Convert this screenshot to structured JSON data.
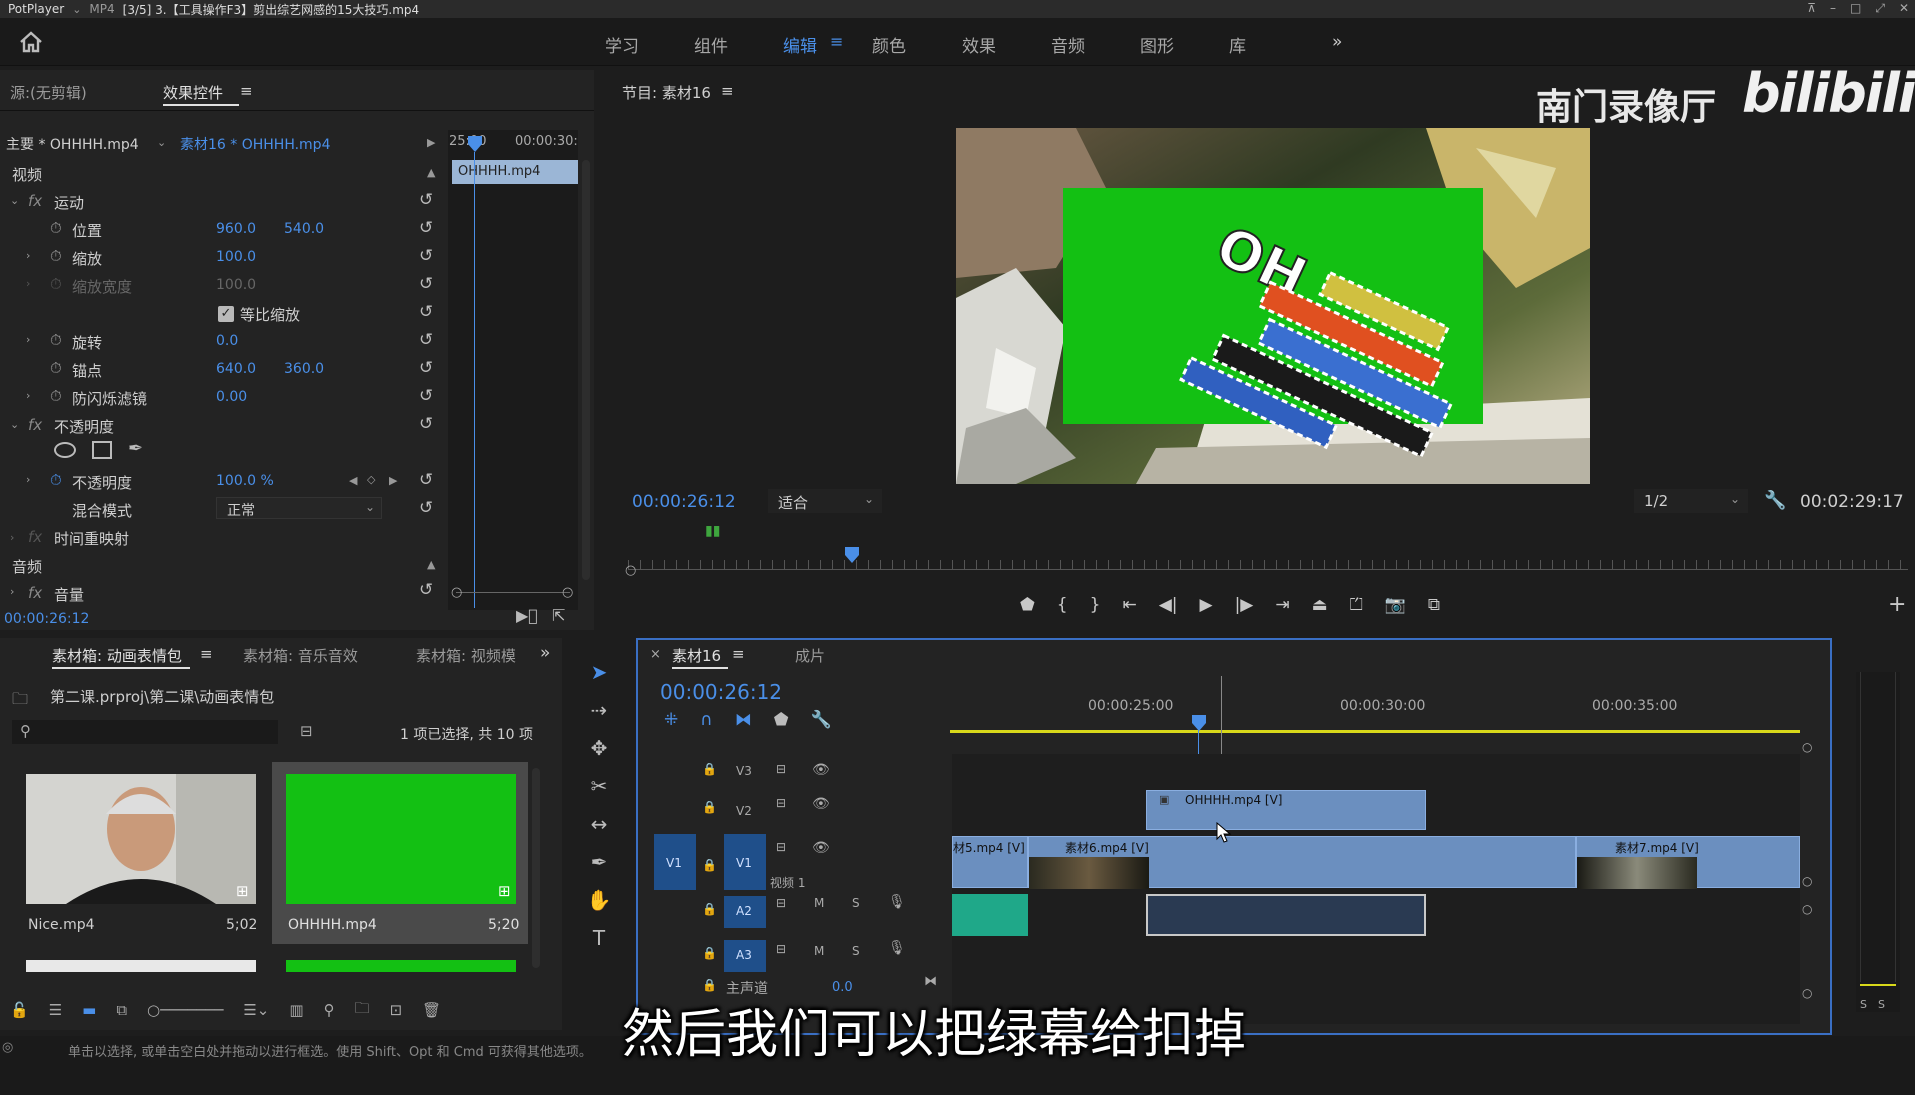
{
  "potplayer": {
    "app": "PotPlayer",
    "format": "MP4",
    "file": "[3/5] 3.【工具操作F3】剪出综艺网感的15大技巧.mp4"
  },
  "workspaces": [
    "学习",
    "组件",
    "编辑",
    "颜色",
    "效果",
    "音频",
    "图形",
    "库"
  ],
  "active_workspace": "编辑",
  "watermark": {
    "channel": "南门录像厅",
    "brand": "bilibili"
  },
  "effect_controls": {
    "source_tab": "源:(无剪辑)",
    "tab": "效果控件",
    "master": "主要 * OHHHH.mp4",
    "sequence_clip": "素材16 * OHHHH.mp4",
    "mini_timeline": {
      "start": "25:00",
      "end": "00:00:30:",
      "clip": "OHHHH.mp4"
    },
    "video_header": "视频",
    "motion": "运动",
    "position": {
      "label": "位置",
      "x": "960.0",
      "y": "540.0"
    },
    "scale": {
      "label": "缩放",
      "value": "100.0"
    },
    "scale_width": {
      "label": "缩放宽度",
      "value": "100.0"
    },
    "uniform_scale": {
      "label": "等比缩放",
      "checked": true
    },
    "rotation": {
      "label": "旋转",
      "value": "0.0"
    },
    "anchor": {
      "label": "锚点",
      "x": "640.0",
      "y": "360.0"
    },
    "flicker": {
      "label": "防闪烁滤镜",
      "value": "0.00"
    },
    "opacity_group": "不透明度",
    "opacity": {
      "label": "不透明度",
      "value": "100.0 %"
    },
    "blend": {
      "label": "混合模式",
      "value": "正常"
    },
    "time_remap": "时间重映射",
    "audio_header": "音频",
    "volume": "音量",
    "timecode": "00:00:26:12"
  },
  "program": {
    "title": "节目: 素材16",
    "timecode": "00:00:26:12",
    "fit": "适合",
    "resolution": "1/2",
    "duration": "00:02:29:17",
    "overlay_text": "OH"
  },
  "bins": {
    "tabs": [
      "素材箱: 动画表情包",
      "素材箱: 音乐音效",
      "素材箱: 视频模"
    ],
    "path": "第二课.prproj\\第二课\\动画表情包",
    "selection": "1 项已选择, 共 10 项",
    "items": [
      {
        "name": "Nice.mp4",
        "duration": "5;02"
      },
      {
        "name": "OHHHH.mp4",
        "duration": "5;20"
      }
    ]
  },
  "timeline": {
    "tabs": [
      "素材16",
      "成片"
    ],
    "timecode": "00:00:26:12",
    "ruler": [
      "00:00:25:00",
      "00:00:30:00",
      "00:00:35:00"
    ],
    "tracks": {
      "v3": "V3",
      "v2": "V2",
      "v1": "V1",
      "v1_src": "V1",
      "v1_name": "视频 1",
      "a2": "A2",
      "a3": "A3",
      "m": "M",
      "s": "S",
      "master": "主声道",
      "master_val": "0.0"
    },
    "clips": {
      "v2": "OHHHH.mp4 [V]",
      "v1a": "材5.mp4 [V]",
      "v1b": "素材6.mp4 [V]",
      "v1c": "素材7.mp4 [V]"
    }
  },
  "status": "单击以选择, 或单击空白处并拖动以进行框选。使用 Shift、Opt 和 Cmd 可获得其他选项。",
  "subtitle": "然后我们可以把绿幕给扣掉",
  "meter": {
    "s1": "S",
    "s2": "S"
  },
  "colors": {
    "accent": "#4a8fe8",
    "green_screen": "#13c013",
    "clip": "#6b8fbf",
    "audio": "#1fa889"
  }
}
